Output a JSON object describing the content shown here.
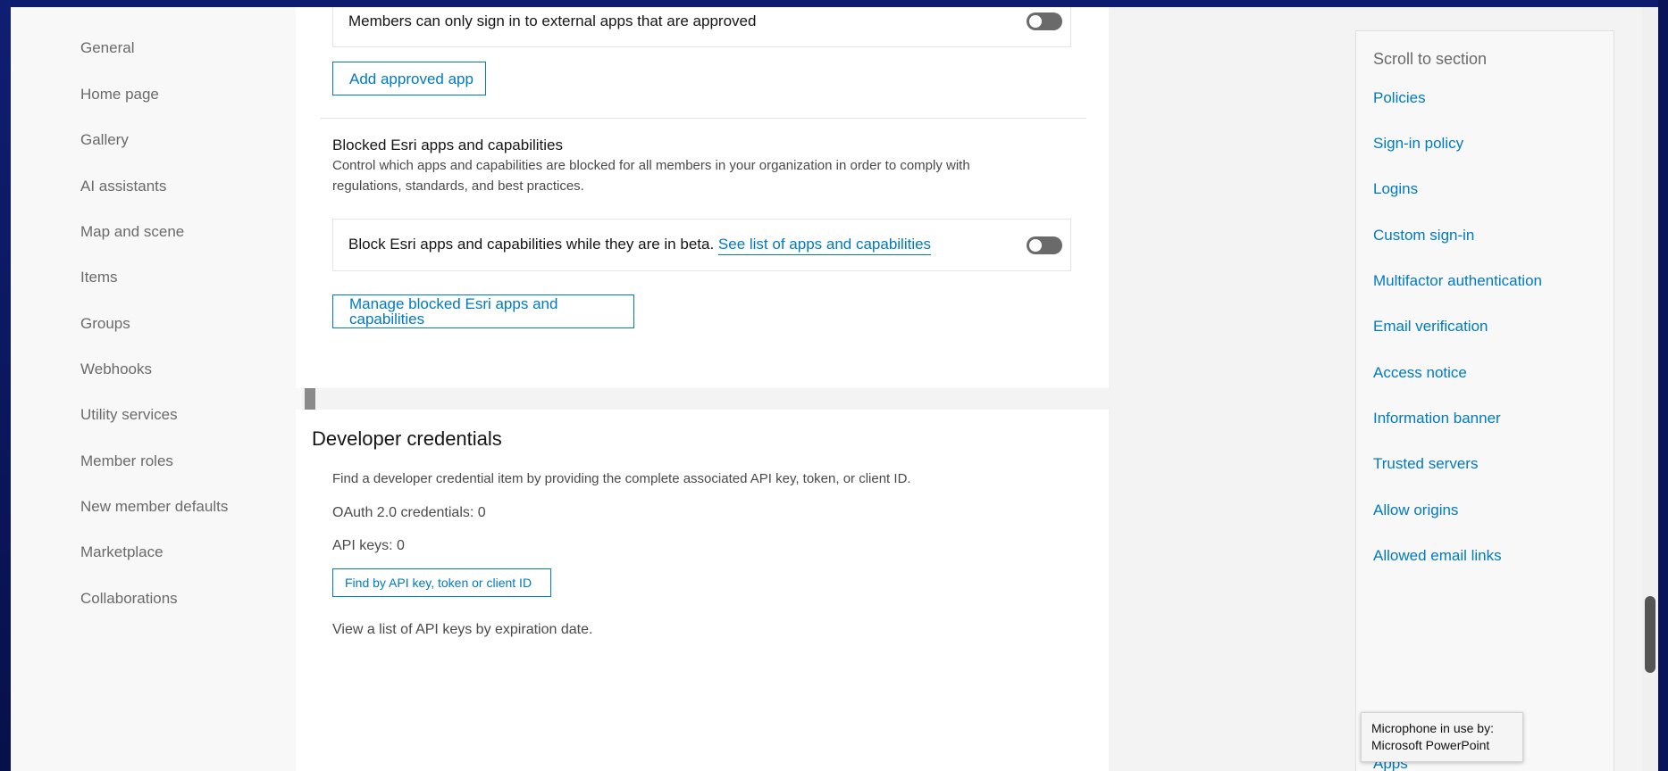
{
  "left_nav": {
    "items": [
      "General",
      "Home page",
      "Gallery",
      "AI assistants",
      "Map and scene",
      "Items",
      "Groups",
      "Webhooks",
      "Utility services",
      "Member roles",
      "New member defaults",
      "Marketplace",
      "Collaborations"
    ]
  },
  "approved_apps": {
    "toggle_label": "Members can only sign in to external apps that are approved",
    "toggle_on": false,
    "add_button": "Add approved app"
  },
  "blocked_apps": {
    "title": "Blocked Esri apps and capabilities",
    "description_line1": "Control which apps and capabilities are blocked for all members in your organization in order to comply with",
    "description_line2": "regulations, standards, and best practices.",
    "toggle_label": "Block Esri apps and capabilities while they are in beta.",
    "toggle_link": "See list of apps and capabilities",
    "toggle_on": false,
    "manage_button": "Manage blocked Esri apps and capabilities"
  },
  "developer_credentials": {
    "title": "Developer credentials",
    "description": "Find a developer credential item by providing the complete associated API key, token, or client ID.",
    "oauth_count": "OAuth 2.0 credentials: 0",
    "api_keys_count": "API keys: 0",
    "find_button": "Find by API key, token or client ID",
    "view_list_text": "View a list of API keys by expiration date."
  },
  "toc": {
    "heading": "Scroll to section",
    "items": [
      "Policies",
      "Sign-in policy",
      "Logins",
      "Custom sign-in",
      "Multifactor authentication",
      "Email verification",
      "Access notice",
      "Information banner",
      "Trusted servers",
      "Allow origins",
      "Allowed email links",
      "Apps"
    ]
  },
  "tooltip": {
    "line1": "Microphone in use by:",
    "line2": "Microsoft PowerPoint"
  },
  "colors": {
    "accent": "#007ac2",
    "frame": "#0a1458",
    "toggle_off": "#6a6a6a"
  }
}
